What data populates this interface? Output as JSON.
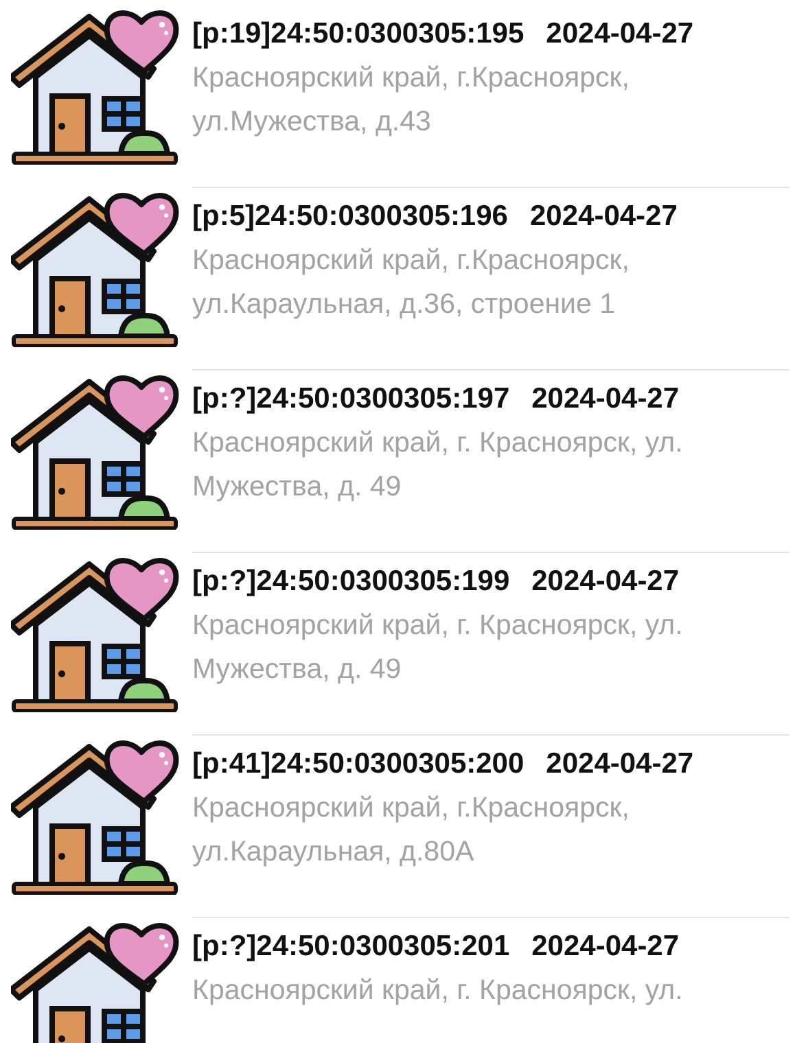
{
  "items": [
    {
      "title": "[p:19]24:50:0300305:195",
      "date": "2024-04-27",
      "address": "Красноярский край, г.Красноярск, ул.Мужества, д.43"
    },
    {
      "title": "[p:5]24:50:0300305:196",
      "date": "2024-04-27",
      "address": "Красноярский край, г.Красноярск, ул.Караульная, д.36, строение 1"
    },
    {
      "title": "[p:?]24:50:0300305:197",
      "date": "2024-04-27",
      "address": "Красноярский край, г. Красноярск, ул. Мужества, д. 49"
    },
    {
      "title": "[p:?]24:50:0300305:199",
      "date": "2024-04-27",
      "address": "Красноярский край, г. Красноярск, ул. Мужества, д. 49"
    },
    {
      "title": "[p:41]24:50:0300305:200",
      "date": "2024-04-27",
      "address": "Красноярский край, г.Красноярск, ул.Караульная, д.80А"
    },
    {
      "title": "[p:?]24:50:0300305:201",
      "date": "2024-04-27",
      "address": "Красноярский край, г. Красноярск, ул."
    }
  ]
}
